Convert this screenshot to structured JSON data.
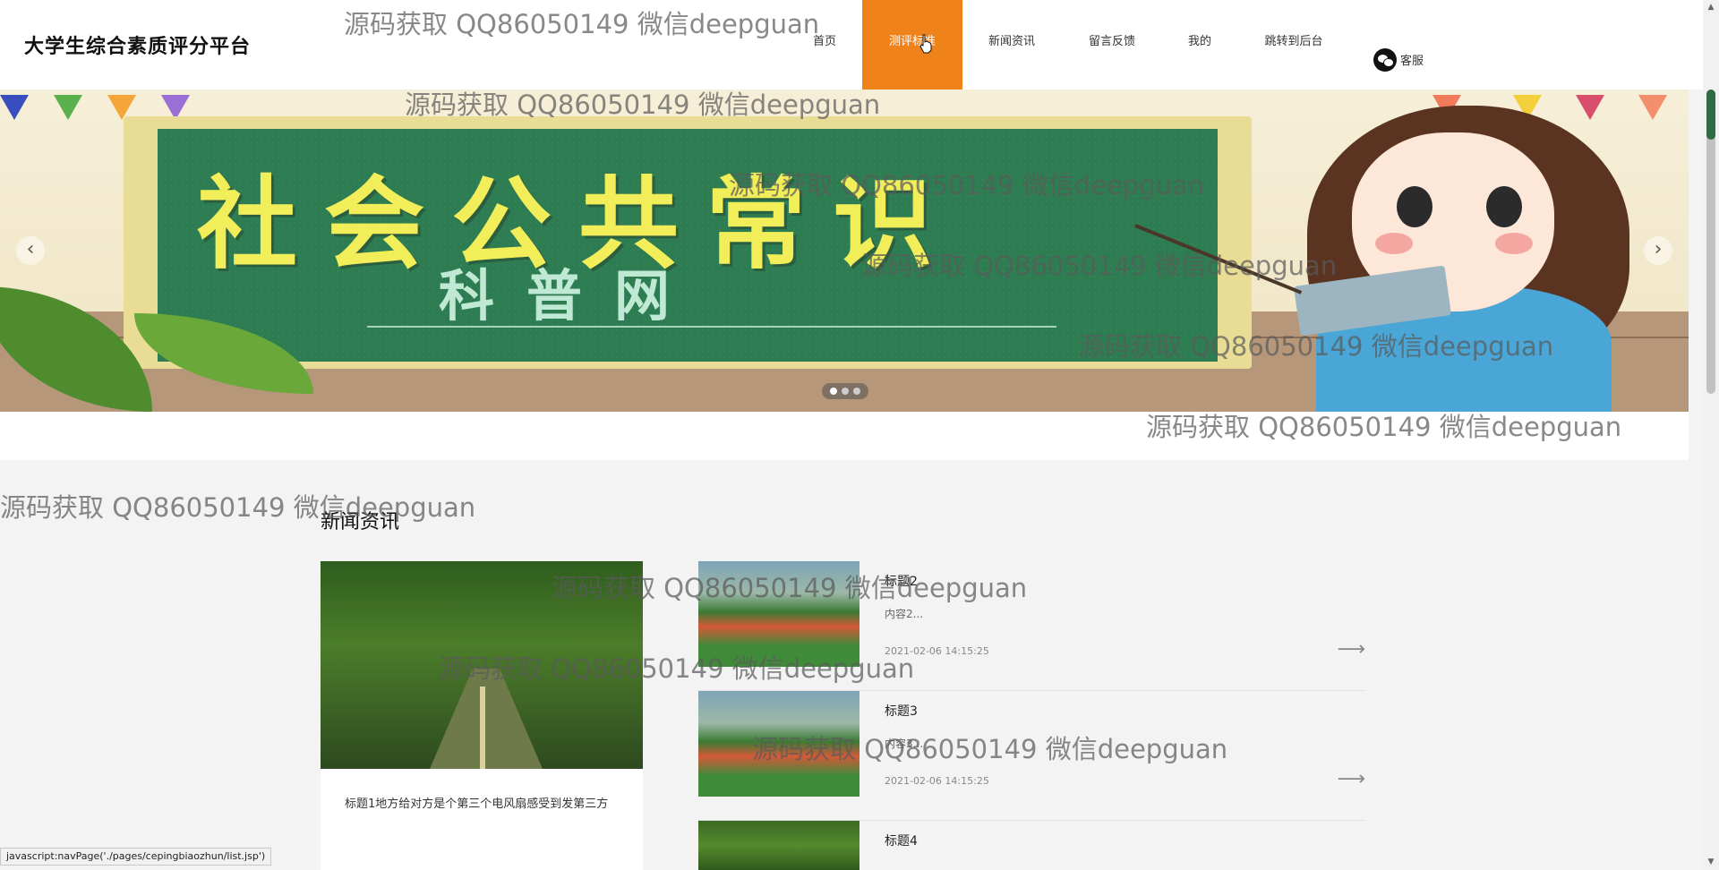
{
  "brand": "大学生综合素质评分平台",
  "nav": {
    "items": [
      {
        "label": "首页"
      },
      {
        "label": "测评标准"
      },
      {
        "label": "新闻资讯"
      },
      {
        "label": "留言反馈"
      },
      {
        "label": "我的"
      },
      {
        "label": "跳转到后台"
      }
    ],
    "service": "客服",
    "active_color": "#f0821a"
  },
  "banner": {
    "title": "社会公共常识",
    "subtitle": "科普网",
    "prev": "‹",
    "next": "›",
    "slide_count": 3,
    "active_slide": 1
  },
  "news": {
    "heading": "新闻资讯",
    "feature": {
      "title": "标题1地方给对方是个第三个电风扇感受到发第三方"
    },
    "items": [
      {
        "title": "标题2",
        "desc": "内容2...",
        "date": "2021-02-06 14:15:25"
      },
      {
        "title": "标题3",
        "desc": "内容3...",
        "date": "2021-02-06 14:15:25"
      },
      {
        "title": "标题4",
        "desc": "",
        "date": ""
      }
    ],
    "arrow": "⟶"
  },
  "status_bar": "javascript:navPage('./pages/cepingbiaozhun/list.jsp')",
  "watermark": "源码获取 QQ86050149 微信deepguan"
}
